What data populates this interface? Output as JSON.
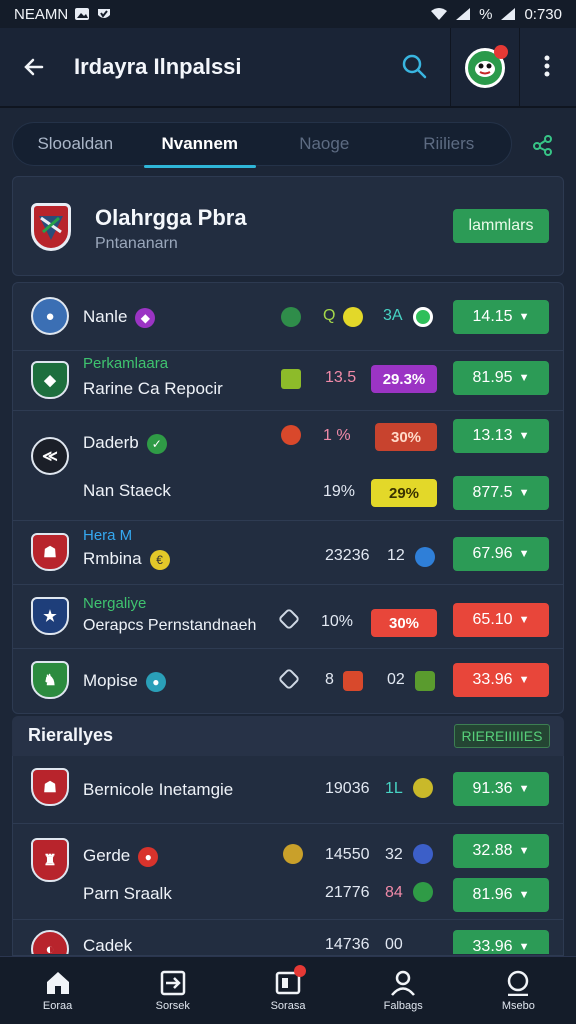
{
  "status_bar": {
    "carrier": "NEAMN",
    "battery": "%",
    "time": "0:730"
  },
  "app_bar": {
    "title": "Irdayra Ilnpalssi"
  },
  "tabs": [
    {
      "label": "Slooaldan",
      "state": "normal"
    },
    {
      "label": "Nvannem",
      "state": "active"
    },
    {
      "label": "Naoge",
      "state": "dim"
    },
    {
      "label": "Riiliers",
      "state": "dim"
    }
  ],
  "league": {
    "name": "Olahrgga Pbra",
    "subtitle": "Pntananarn",
    "button": "lammlars"
  },
  "matches": [
    {
      "tag": "",
      "name": "Nanle",
      "s1": "Q",
      "s2": "3A",
      "pill": "",
      "odds": "14.15",
      "odds_color": "green"
    },
    {
      "tag": "Perkamlaara",
      "name": "Rarine Ca Repocir",
      "s1": "13.5",
      "s2": "",
      "pill": "29.3%",
      "odds": "81.95",
      "odds_color": "green"
    },
    {
      "tag": "",
      "name": "Daderb",
      "s1": "1 %",
      "s2": "",
      "pill": "30%",
      "odds": "13.13",
      "odds_color": "green"
    },
    {
      "tag": "",
      "name": "Nan Staeck",
      "s1": "19%",
      "s2": "",
      "pill": "29%",
      "odds": "877.5",
      "odds_color": "green"
    },
    {
      "tag": "Hera M",
      "name": "Rmbina",
      "s1": "23236",
      "s2": "12",
      "pill": "",
      "odds": "67.96",
      "odds_color": "green"
    },
    {
      "tag": "Nergaliye",
      "name": "Oerapcs Pernstandnaeh",
      "s1": "10%",
      "s2": "",
      "pill": "30%",
      "odds": "65.10",
      "odds_color": "red"
    },
    {
      "tag": "",
      "name": "Mopise",
      "s1": "8",
      "s2": "02",
      "pill": "",
      "odds": "33.96",
      "odds_color": "red"
    }
  ],
  "section": {
    "title": "Rierallyes",
    "badge": "RIEREIIIIIES"
  },
  "matches2": [
    {
      "name": "Bernicole Inetamgie",
      "s1": "19036",
      "s2": "1L",
      "odds": "91.36"
    },
    {
      "name": "Gerde",
      "s1": "14550",
      "s2": "32",
      "odds": "32.88"
    },
    {
      "name": "Parn Sraalk",
      "s1": "21776",
      "s2": "84",
      "odds": "81.96"
    },
    {
      "name": "Cadek",
      "s1": "14736",
      "s2": "00",
      "odds": "33.96"
    }
  ],
  "bottom_nav": [
    {
      "label": "Eoraa",
      "icon": "home-icon"
    },
    {
      "label": "Sorsek",
      "icon": "transfer-icon"
    },
    {
      "label": "Sorasa",
      "icon": "card-icon"
    },
    {
      "label": "Falbags",
      "icon": "person-icon"
    },
    {
      "label": "Msebo",
      "icon": "profile-icon"
    }
  ],
  "colors": {
    "accent": "#2fb6d8",
    "green": "#2c9b56",
    "red": "#e8463a",
    "purple": "#9b34c4",
    "yellow": "#e3d829",
    "orange_red": "#c8432e"
  }
}
